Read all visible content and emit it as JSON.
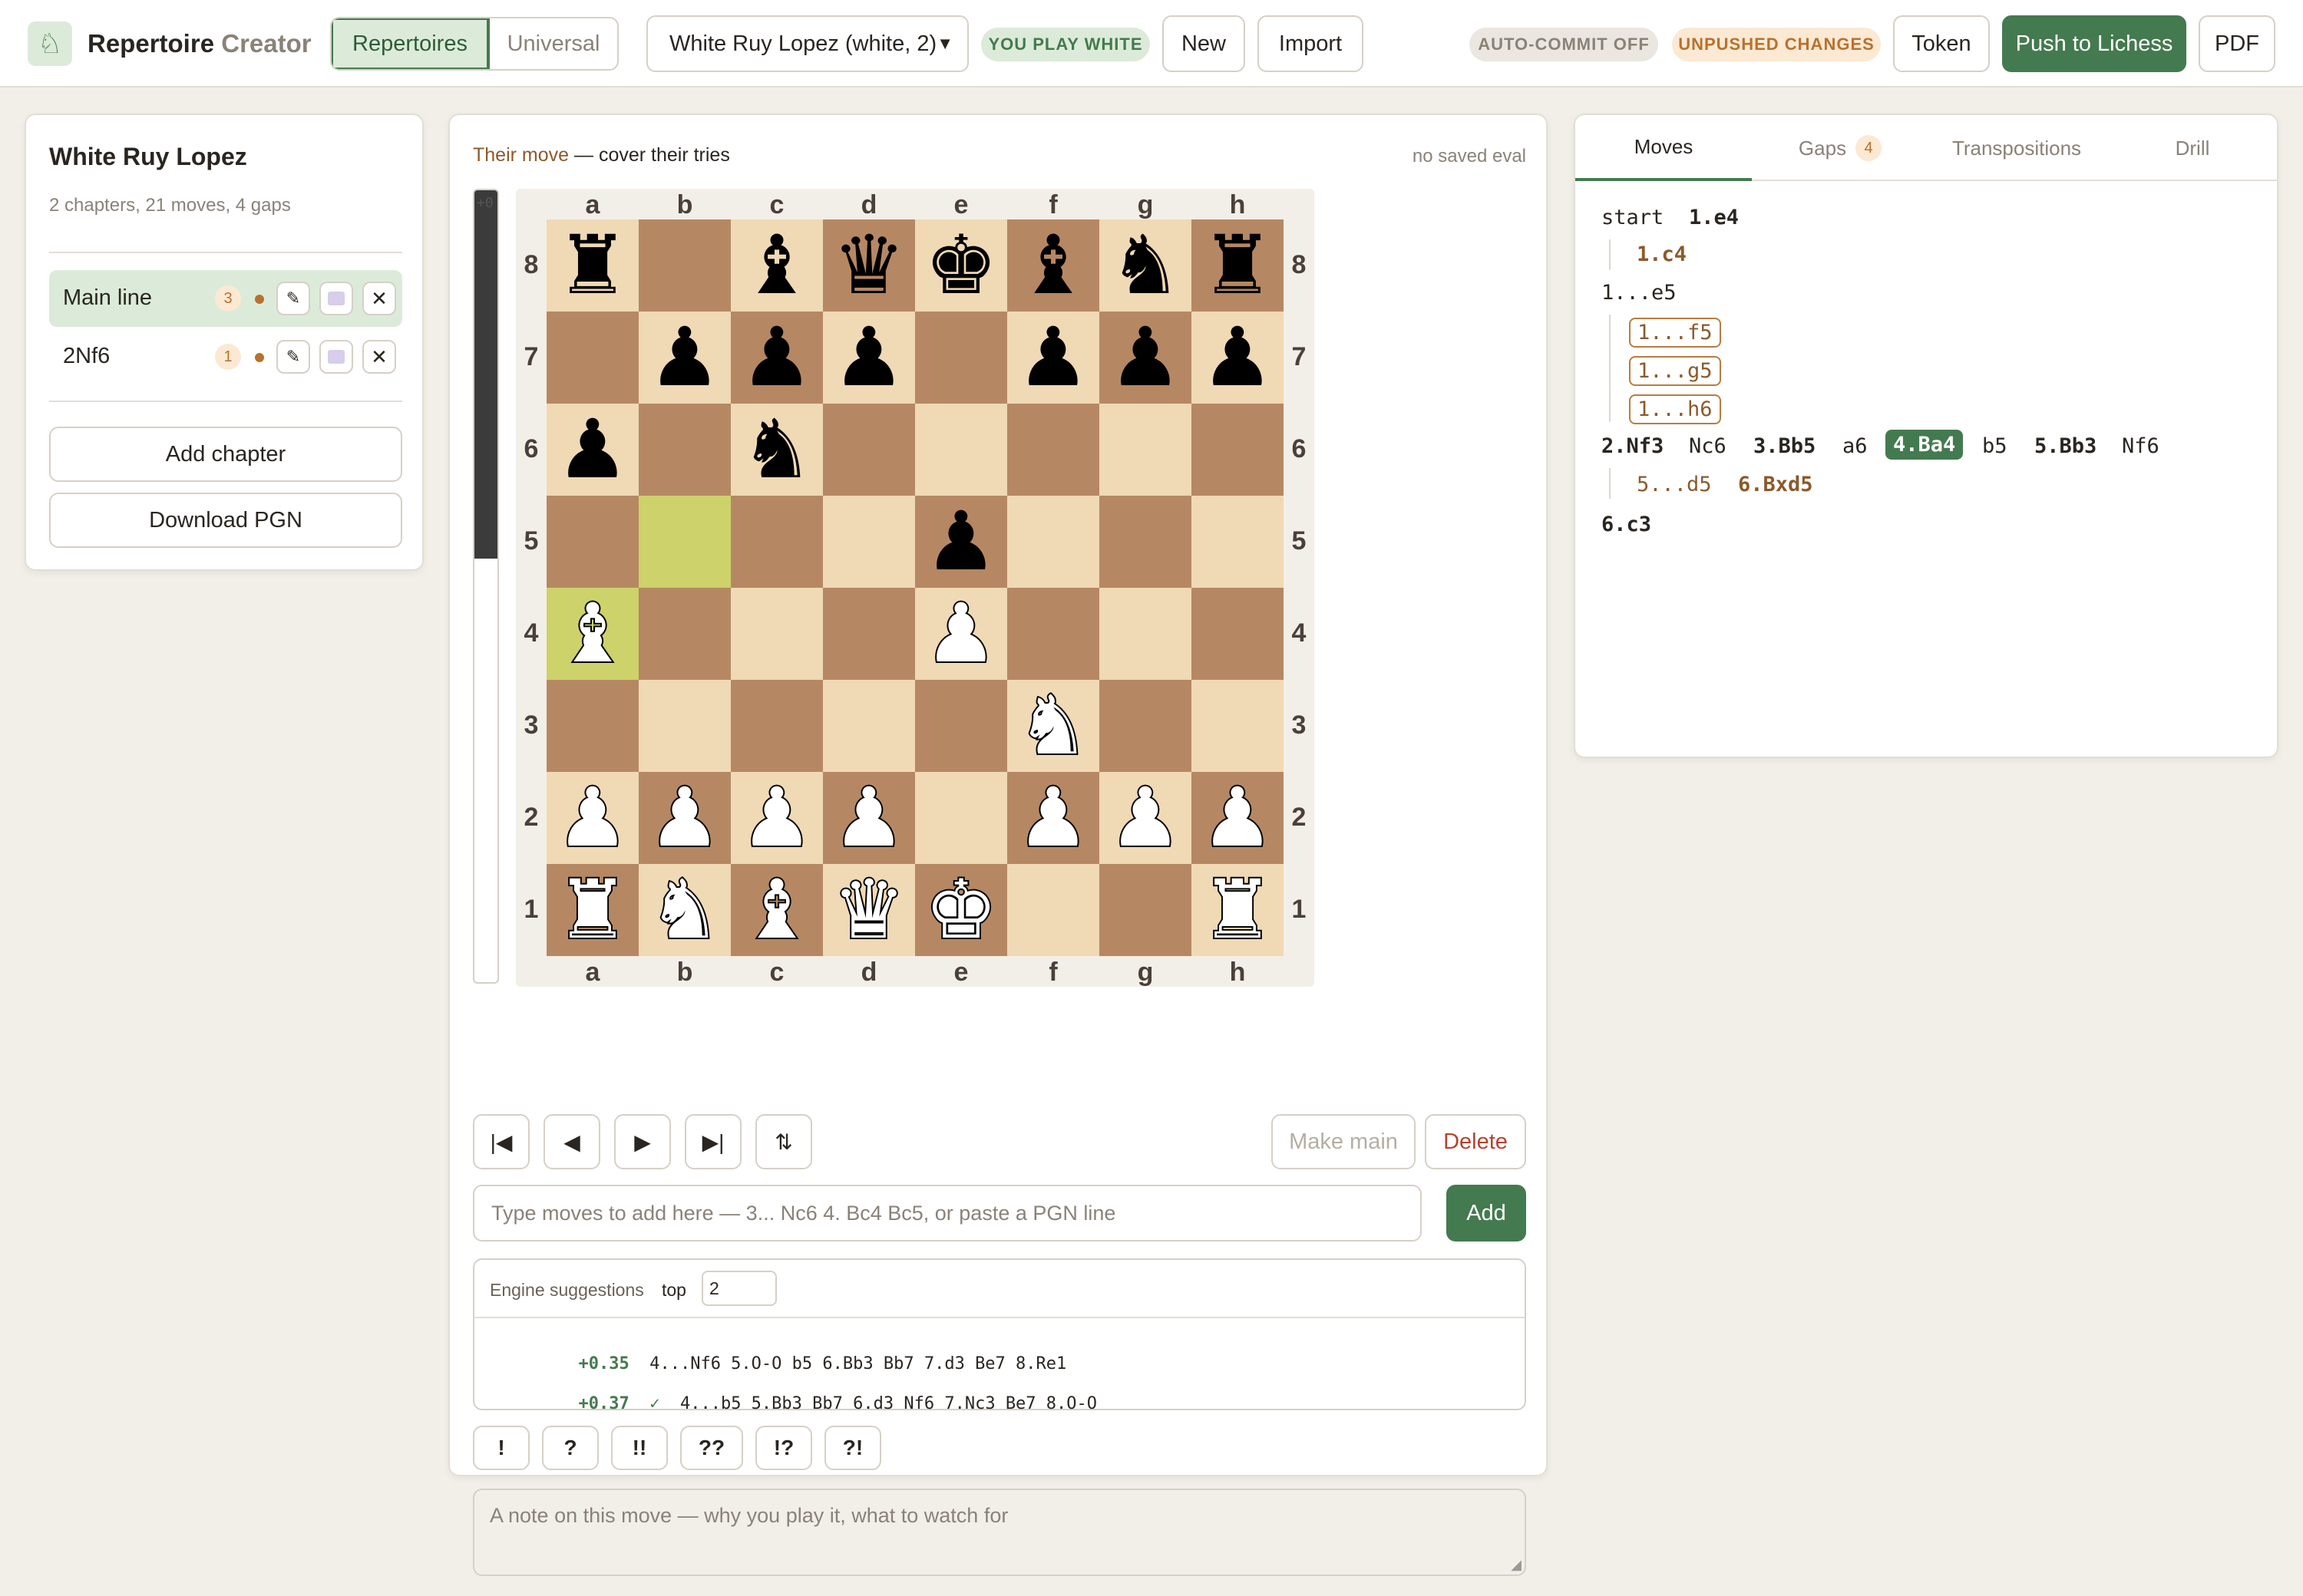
{
  "app": {
    "title_main": "Repertoire",
    "title_accent": "Creator",
    "logo_icon": "chess-knight-icon"
  },
  "header": {
    "tabs": [
      {
        "label": "Repertoires",
        "active": true
      },
      {
        "label": "Universal",
        "active": false
      }
    ],
    "repertoire_select": "White Ruy Lopez (white, 2)",
    "play_badge": "YOU PLAY WHITE",
    "new_label": "New",
    "import_label": "Import",
    "autocommit_badge": "AUTO-COMMIT OFF",
    "unpushed_badge": "UNPUSHED CHANGES",
    "token_label": "Token",
    "push_label": "Push to Lichess",
    "pdf_label": "PDF"
  },
  "sidebar": {
    "title": "White Ruy Lopez",
    "stats": "2 chapters, 21 moves, 4 gaps",
    "chapters": [
      {
        "name": "Main line",
        "count": "3",
        "active": true
      },
      {
        "name": "2Nf6",
        "count": "1",
        "active": false
      }
    ],
    "add_chapter": "Add chapter",
    "download_pgn": "Download PGN"
  },
  "board": {
    "turn_label": "Their move",
    "turn_hint": "— cover their tries",
    "eval_status": "no saved eval",
    "eval_bar_label": "+0",
    "files": [
      "a",
      "b",
      "c",
      "d",
      "e",
      "f",
      "g",
      "h"
    ],
    "ranks": [
      "8",
      "7",
      "6",
      "5",
      "4",
      "3",
      "2",
      "1"
    ],
    "last_move_squares": [
      "b5",
      "a4"
    ],
    "position": [
      [
        "r",
        "",
        "b",
        "q",
        "k",
        "b",
        "n",
        "r"
      ],
      [
        "",
        "p",
        "p",
        "p",
        "",
        "p",
        "p",
        "p"
      ],
      [
        "p",
        "",
        "n",
        "",
        "",
        "",
        "",
        ""
      ],
      [
        "",
        "",
        "",
        "",
        "p",
        "",
        "",
        ""
      ],
      [
        "B",
        "",
        "",
        "",
        "P",
        "",
        "",
        ""
      ],
      [
        "",
        "",
        "",
        "",
        "",
        "N",
        "",
        ""
      ],
      [
        "P",
        "P",
        "P",
        "P",
        "",
        "P",
        "P",
        "P"
      ],
      [
        "R",
        "N",
        "B",
        "Q",
        "K",
        "",
        "",
        "R"
      ]
    ],
    "colors": {
      "light": "#f0d9b5",
      "dark": "#b58863",
      "highlight": "#cdd26a",
      "highlight_dark": "#aaa23a"
    }
  },
  "controls": {
    "first_icon": "|◀",
    "prev_icon": "◀",
    "next_icon": "▶",
    "last_icon": "▶|",
    "flip_icon": "⇅",
    "make_main": "Make main",
    "delete": "Delete",
    "input_placeholder": "Type moves to add here — 3... Nc6 4. Bc4 Bc5, or paste a PGN line",
    "add_label": "Add"
  },
  "engine": {
    "title": "Engine suggestions",
    "top_label": "top",
    "top_value": "2",
    "lines": [
      {
        "eval": "+0.35",
        "check": "",
        "moves": "4...Nf6 5.O-O b5 6.Bb3 Bb7 7.d3 Be7 8.Re1"
      },
      {
        "eval": "+0.37",
        "check": "✓",
        "moves": "4...b5 5.Bb3 Bb7 6.d3 Nf6 7.Nc3 Be7 8.O-O"
      }
    ]
  },
  "annotations": [
    "!",
    "?",
    "!!",
    "??",
    "!?",
    "?!"
  ],
  "note_placeholder": "A note on this move — why you play it, what to watch for",
  "tree": {
    "tabs": [
      {
        "label": "Moves",
        "active": true
      },
      {
        "label": "Gaps",
        "badge": "4"
      },
      {
        "label": "Transpositions"
      },
      {
        "label": "Drill"
      }
    ],
    "rows": {
      "start": "start",
      "e4": "1.e4",
      "c4": "1.c4",
      "e5": "1...e5",
      "f5": "1...f5",
      "g5": "1...g5",
      "h6": "1...h6",
      "main": [
        "2.Nf3",
        "Nc6",
        "3.Bb5",
        "a6",
        "4.Ba4",
        "b5",
        "5.Bb3",
        "Nf6"
      ],
      "d5": "5...d5",
      "bxd5": "6.Bxd5",
      "c3": "6.c3"
    }
  }
}
